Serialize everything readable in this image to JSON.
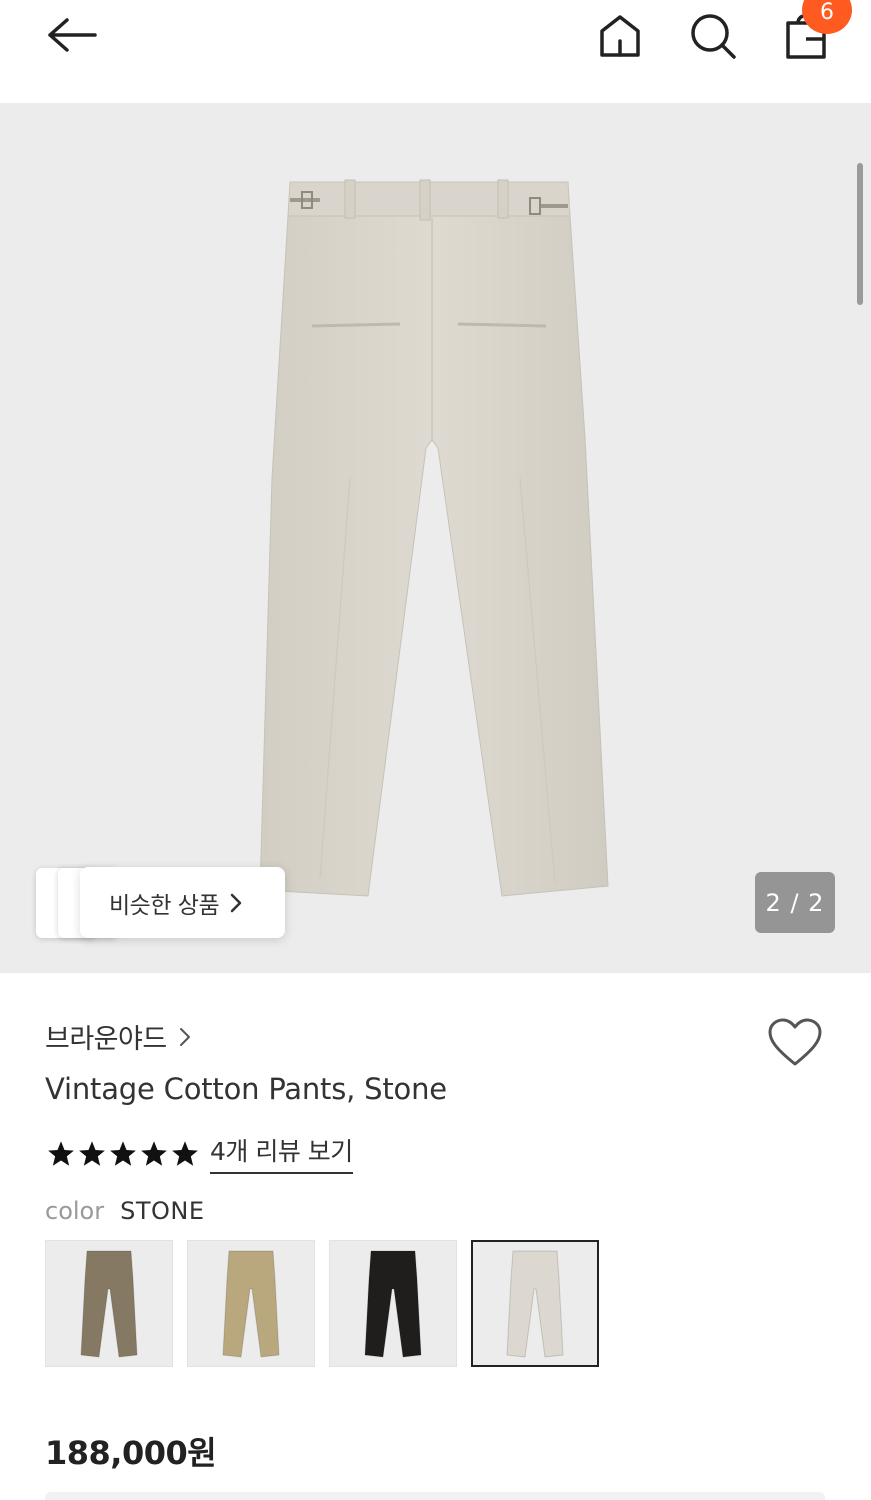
{
  "header": {
    "back_icon": "arrow-left-icon",
    "home_icon": "home-icon",
    "search_icon": "search-icon",
    "bag_icon": "shopping-bag-icon",
    "cart_count": "6",
    "badge_color": "#ff5a1f"
  },
  "gallery": {
    "similar_label": "비슷한 상품",
    "similar_icon": "chevron-right-icon",
    "page_counter": "2 / 2",
    "background": "#ececec"
  },
  "product": {
    "brand": "브라운야드",
    "brand_icon": "chevron-right-icon",
    "wishlist_icon": "heart-outline-icon",
    "title": "Vintage Cotton Pants, Stone",
    "rating": 5,
    "rating_max": 5,
    "review_link": "4개 리뷰 보기",
    "color_label": "color",
    "color_value": "STONE",
    "price": "188,000원"
  },
  "swatches": [
    {
      "color": "#857963",
      "selected": false
    },
    {
      "color": "#b9a77e",
      "selected": false
    },
    {
      "color": "#1f1e1d",
      "selected": false
    },
    {
      "color": "#dcd8cf",
      "selected": true
    }
  ]
}
